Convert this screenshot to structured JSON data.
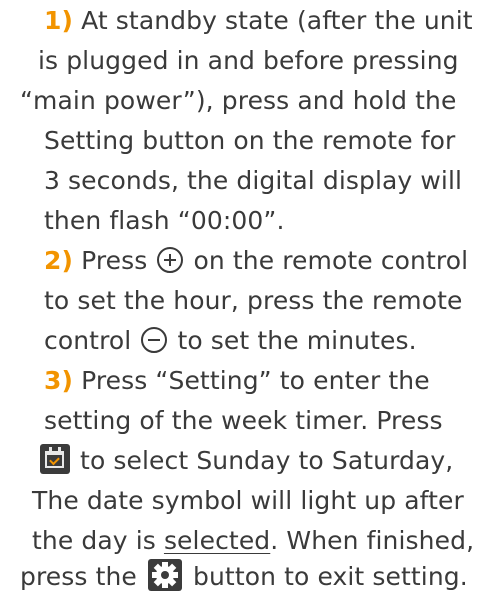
{
  "steps": [
    {
      "number": "1)",
      "lines": [
        "At standby state (after the unit",
        "is plugged in and before pressing",
        "“main power”), press and hold the",
        "Setting button on the remote for",
        "3 seconds, the digital display will",
        "then flash “00:00”."
      ]
    },
    {
      "number": "2)",
      "line1_before": "Press",
      "line1_after": "on the remote control",
      "line2": "to set the hour, press the remote",
      "line3_before": "control",
      "line3_after": "to set the minutes."
    },
    {
      "number": "3)",
      "line1": "Press “Setting” to enter the",
      "line2": "setting of the week timer. Press",
      "line3_after": "to select Sunday to Saturday,",
      "line4": "The date symbol will light up after",
      "line5_before": "the day is ",
      "line5_underlined": "selected",
      "line5_after": ". When finished,",
      "line6_before": "press the",
      "line6_after": "button to exit setting."
    }
  ],
  "icons": {
    "plus": "plus-circle-icon",
    "minus": "minus-circle-icon",
    "calendar": "calendar-check-icon",
    "gear": "gear-icon"
  },
  "colors": {
    "accent": "#f29400",
    "text": "#3a3a3a",
    "icon_background": "#3b3b3b"
  }
}
